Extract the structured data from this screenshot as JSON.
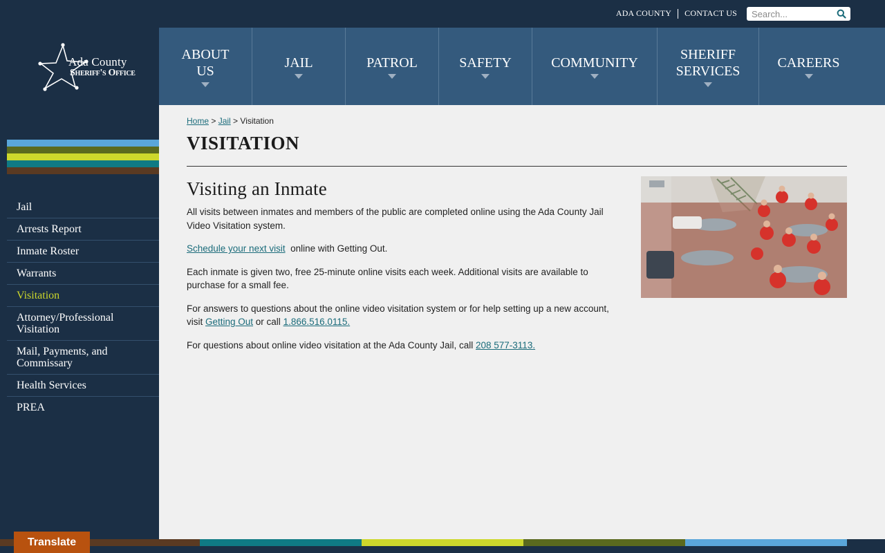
{
  "topbar": {
    "links": [
      "ADA COUNTY",
      "CONTACT US"
    ],
    "search_placeholder": "Search..."
  },
  "logo": {
    "line1": "Ada County",
    "line2": "Sheriff's Office"
  },
  "main_nav": {
    "items": [
      {
        "label": "ABOUT US",
        "lines": [
          "ABOUT",
          "US"
        ]
      },
      {
        "label": "JAIL",
        "lines": [
          "JAIL"
        ]
      },
      {
        "label": "PATROL",
        "lines": [
          "PATROL"
        ]
      },
      {
        "label": "SAFETY",
        "lines": [
          "SAFETY"
        ]
      },
      {
        "label": "COMMUNITY",
        "lines": [
          "COMMUNITY"
        ]
      },
      {
        "label": "SHERIFF SERVICES",
        "lines": [
          "SHERIFF",
          "SERVICES"
        ]
      },
      {
        "label": "CAREERS",
        "lines": [
          "CAREERS"
        ]
      }
    ]
  },
  "side_nav": {
    "items": [
      "Jail",
      "Arrests Report",
      "Inmate Roster",
      "Warrants",
      "Visitation",
      "Attorney/Professional Visitation",
      "Mail, Payments, and Commissary",
      "Health Services",
      "PREA"
    ],
    "active": "Visitation"
  },
  "breadcrumb": {
    "home": "Home",
    "sep1": " > ",
    "jail": "Jail",
    "sep2": " > ",
    "current": "Visitation"
  },
  "page": {
    "title": "VISITATION",
    "heading": "Visiting an Inmate",
    "p1": "All visits between inmates and members of the public are completed online using the Ada County Jail Video Visitation system.",
    "p2_link": "Schedule your next visit",
    "p2_rest": "  online with Getting Out.",
    "p3": "Each inmate is given two, free 25-minute online visits each week. Additional visits are available to purchase for a small fee.",
    "p4_start": "For answers to questions about the online video visitation system or for help setting up a new account, visit ",
    "p4_link1": "Getting Out",
    "p4_mid": " or call ",
    "p4_link2": "1.866.516.0115.",
    "p5_start": "For questions about online video visitation at the Ada County Jail, call ",
    "p5_link": "208 577-3113."
  },
  "translate_label": "Translate",
  "colors": {
    "navy": "#1b2f45",
    "nav_blue": "#345a7d",
    "content_bg": "#f0f0f0",
    "link_teal": "#1a6b7a",
    "active_yellow": "#cbd62b",
    "translate_orange": "#b8520f",
    "stripes": [
      "#5aa6da",
      "#5b6a1e",
      "#cdd82c",
      "#0f7a84",
      "#5a3a22"
    ]
  }
}
